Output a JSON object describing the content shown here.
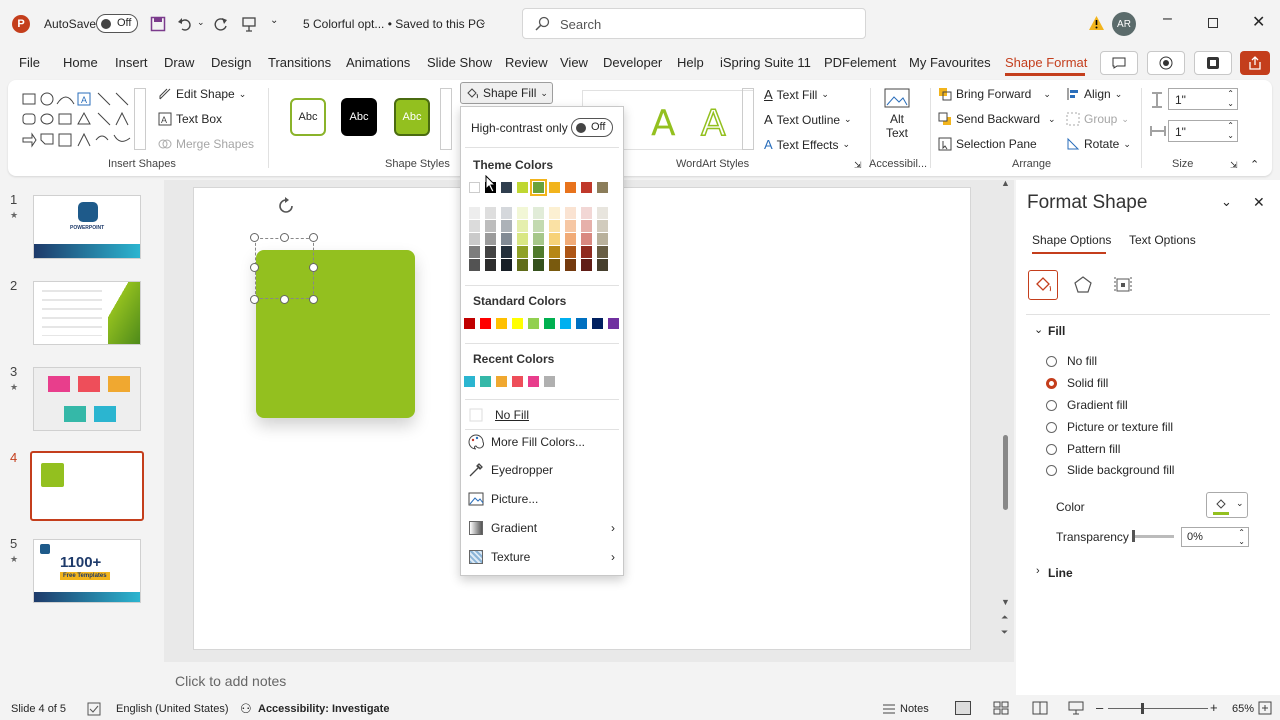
{
  "titlebar": {
    "autosave_label": "AutoSave",
    "autosave_state": "Off",
    "doc_title": "5 Colorful opt... • Saved to this PC",
    "search_placeholder": "Search",
    "avatar_initials": "AR"
  },
  "menu": {
    "tabs": [
      "File",
      "Home",
      "Insert",
      "Draw",
      "Design",
      "Transitions",
      "Animations",
      "Slide Show",
      "Review",
      "View",
      "Developer",
      "Help",
      "iSpring Suite 11",
      "PDFelement",
      "My Favourites",
      "Shape Format"
    ],
    "active_tab": "Shape Format"
  },
  "ribbon": {
    "edit_shape": "Edit Shape",
    "text_box": "Text Box",
    "merge_shapes": "Merge Shapes",
    "insert_shapes_label": "Insert Shapes",
    "style_sample": "Abc",
    "shape_styles_label": "Shape Styles",
    "shape_fill": "Shape Fill",
    "text_fill": "Text Fill",
    "text_outline": "Text Outline",
    "text_effects": "Text Effects",
    "wordart_label": "WordArt Styles",
    "alt_text_1": "Alt",
    "alt_text_2": "Text",
    "accessibility_label": "Accessibil...",
    "bring_forward": "Bring Forward",
    "send_backward": "Send Backward",
    "selection_pane": "Selection Pane",
    "align": "Align",
    "group": "Group",
    "rotate": "Rotate",
    "arrange_label": "Arrange",
    "height_value": "1\"",
    "width_value": "1\"",
    "size_label": "Size"
  },
  "dropdown": {
    "high_contrast": "High-contrast only",
    "toggle_state": "Off",
    "theme_colors": "Theme Colors",
    "standard_colors": "Standard Colors",
    "recent_colors": "Recent Colors",
    "no_fill": "No Fill",
    "more_colors": "More Fill Colors...",
    "eyedropper": "Eyedropper",
    "picture": "Picture...",
    "gradient": "Gradient",
    "texture": "Texture",
    "theme_top": [
      "#ffffff",
      "#000000",
      "#2f3e4e",
      "#bfd732",
      "#6aa23a",
      "#f2b41c",
      "#e8731c",
      "#c0392b",
      "#8b7d5a"
    ],
    "standard": [
      "#c00000",
      "#ff0000",
      "#ffc000",
      "#ffff00",
      "#92d050",
      "#00b050",
      "#00b0f0",
      "#0070c0",
      "#002060",
      "#7030a0"
    ],
    "recent": [
      "#2bb5d0",
      "#35b8a8",
      "#f0a830",
      "#ee4e5a",
      "#e83e8c",
      "#b0b0b0"
    ]
  },
  "slides": {
    "numbers": [
      "1",
      "2",
      "3",
      "4",
      "5"
    ],
    "thumb5_big": "1100+",
    "thumb5_sub": "Free Templates",
    "thumb1_logo": "POWERPOINT"
  },
  "notes_placeholder": "Click to add notes",
  "format_pane": {
    "title": "Format Shape",
    "tab_shape": "Shape Options",
    "tab_text": "Text Options",
    "fill_section": "Fill",
    "options": [
      "No fill",
      "Solid fill",
      "Gradient fill",
      "Picture or texture fill",
      "Pattern fill",
      "Slide background fill"
    ],
    "selected_option": "Solid fill",
    "color_label": "Color",
    "transparency_label": "Transparency",
    "transparency_value": "0%",
    "line_section": "Line"
  },
  "status": {
    "slide_info": "Slide 4 of 5",
    "language": "English (United States)",
    "accessibility": "Accessibility: Investigate",
    "notes": "Notes",
    "zoom": "65%"
  },
  "colors": {
    "accent": "#c43e1c",
    "shape_green": "#93c01f"
  }
}
